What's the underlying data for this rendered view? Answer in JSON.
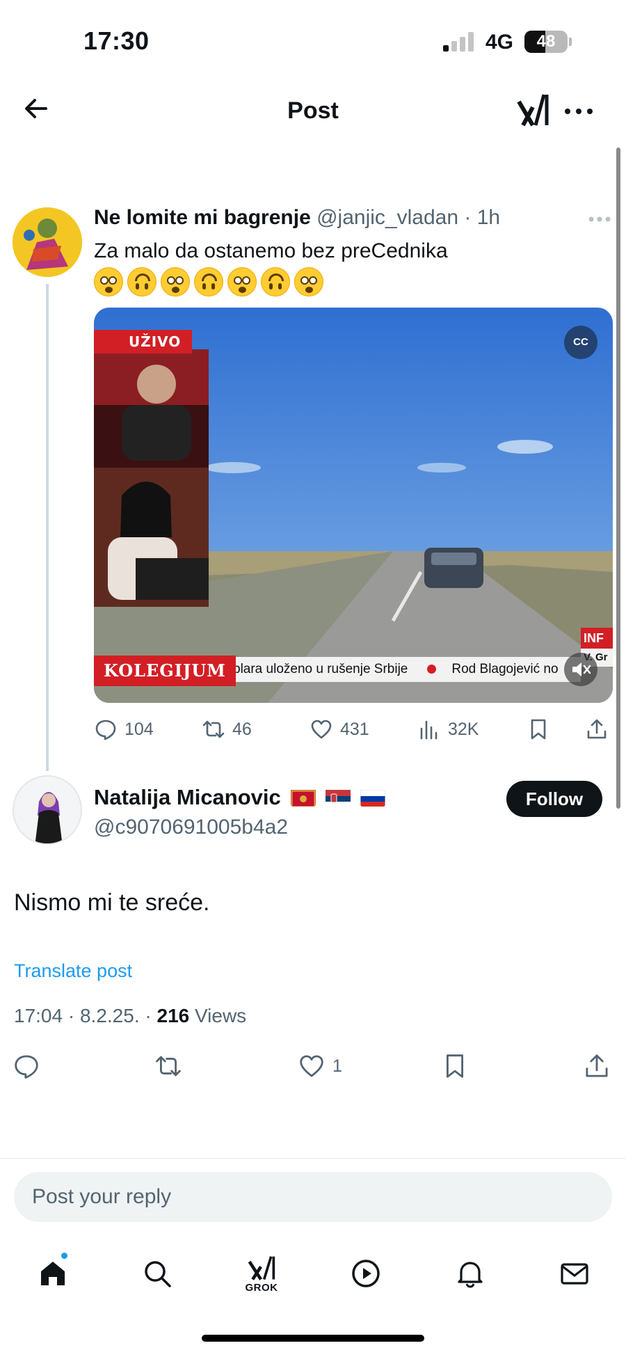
{
  "status_bar": {
    "time": "17:30",
    "network": "4G",
    "battery": "48",
    "battery_level": 0.48
  },
  "header": {
    "title": "Post",
    "back_icon": "arrow-left-icon",
    "logo_icon": "grok-logo-icon",
    "more_icon": "more-horizontal-icon"
  },
  "parent_post": {
    "author_name": "Ne lomite mi bagrenje",
    "handle": "@janjic_vladan",
    "separator": "·",
    "time": "1h",
    "text": "Za malo da ostanemo bez preCednika",
    "emojis": [
      "flushed",
      "upside-down",
      "flushed",
      "upside-down",
      "flushed",
      "upside-down",
      "flushed"
    ],
    "video": {
      "live_label": "UŽIVO",
      "cc_label": "CC",
      "show_name": "KOLEGIJUM",
      "ticker_text_1": "plara uloženo u rušenje Srbije",
      "ticker_text_2": "Rod Blagojević no",
      "ticker_tag": "INF",
      "ticker_tag_2": "V. Gr"
    },
    "stats": {
      "replies": "104",
      "reposts": "46",
      "likes": "431",
      "views": "32K"
    }
  },
  "reply_post": {
    "author_name": "Natalija Micanovic",
    "flags": [
      "Montenegro",
      "Serbia",
      "Russia"
    ],
    "handle": "@c9070691005b4a2",
    "follow_label": "Follow",
    "text": "Nismo mi te sreće.",
    "translate_label": "Translate post",
    "time": "17:04",
    "date": "8.2.25.",
    "dot": "·",
    "views_count": "216",
    "views_label": "Views",
    "likes": "1"
  },
  "reply_box": {
    "placeholder": "Post your reply"
  },
  "bottom_nav": {
    "items": [
      {
        "name": "home",
        "icon": "home-icon"
      },
      {
        "name": "search",
        "icon": "search-icon"
      },
      {
        "name": "grok",
        "icon": "grok-icon",
        "label": "GROK"
      },
      {
        "name": "videos",
        "icon": "play-circle-icon"
      },
      {
        "name": "notifications",
        "icon": "bell-icon"
      },
      {
        "name": "messages",
        "icon": "envelope-icon"
      }
    ]
  },
  "colors": {
    "accent": "#1d9bf0",
    "text": "#0f1419",
    "muted": "#536471",
    "live_red": "#d21f25"
  }
}
